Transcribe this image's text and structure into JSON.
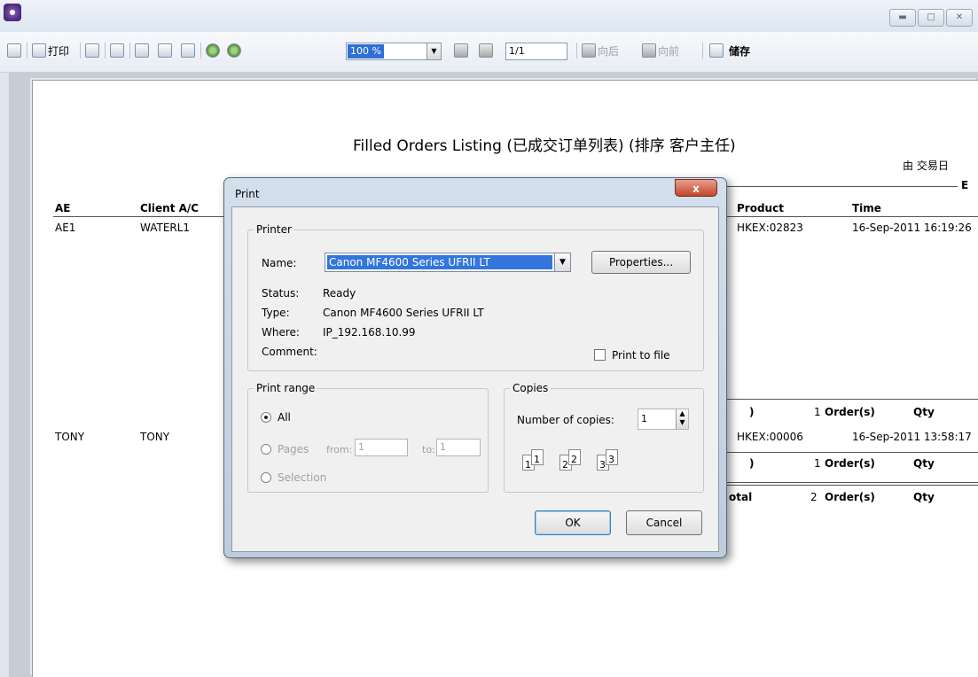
{
  "toolbar": {
    "print_label": "打印",
    "zoom_value": "100 %",
    "page_value": "1/1",
    "back_label": "向后",
    "forward_label": "向前",
    "save_label": "储存"
  },
  "report": {
    "title": "Filled Orders Listing (已成交订单列表) (排序 客户主任)",
    "by_label": "由 交易日",
    "corner_label": "E",
    "columns": {
      "ae": "AE",
      "client": "Client A/C",
      "product": "Product",
      "time": "Time"
    },
    "rows": [
      {
        "ae": "AE1",
        "client": "WATERL1",
        "product": "HKEX:02823",
        "time": "16-Sep-2011 16:19:26"
      },
      {
        "ae": "TONY",
        "client": "TONY",
        "product": "HKEX:00006",
        "time": "16-Sep-2011 13:58:17"
      }
    ],
    "subtotals": [
      {
        "paren": ")",
        "count": "1",
        "orders": "Order(s)",
        "qty": "Qty"
      },
      {
        "paren": ")",
        "count": "1",
        "orders": "Order(s)",
        "qty": "Qty"
      }
    ],
    "total": {
      "label": "otal",
      "count": "2",
      "orders": "Order(s)",
      "qty": "Qty"
    }
  },
  "dialog": {
    "title": "Print",
    "close": "x",
    "printer": {
      "group_label": "Printer",
      "name_label": "Name:",
      "name_value": "Canon MF4600 Series UFRII LT",
      "properties_button": "Properties...",
      "status_label": "Status:",
      "status_value": "Ready",
      "type_label": "Type:",
      "type_value": "Canon MF4600 Series UFRII LT",
      "where_label": "Where:",
      "where_value": "IP_192.168.10.99",
      "comment_label": "Comment:",
      "print_to_file": "Print to file"
    },
    "range": {
      "group_label": "Print range",
      "all": "All",
      "pages": "Pages",
      "from_label": "from:",
      "from_value": "1",
      "to_label": "to:",
      "to_value": "1",
      "selection": "Selection"
    },
    "copies": {
      "group_label": "Copies",
      "number_label": "Number of copies:",
      "number_value": "1",
      "collate_icons": [
        "1",
        "1",
        "2",
        "2",
        "3",
        "3"
      ]
    },
    "ok_button": "OK",
    "cancel_button": "Cancel"
  }
}
